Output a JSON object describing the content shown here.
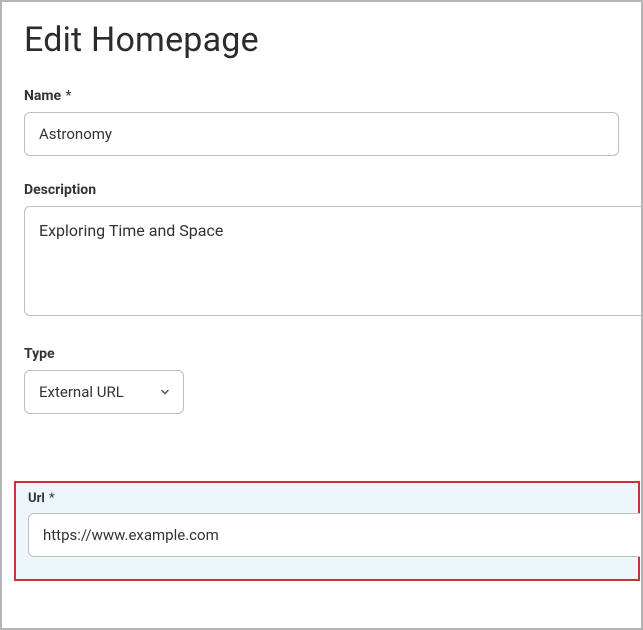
{
  "page": {
    "title": "Edit Homepage"
  },
  "fields": {
    "name": {
      "label": "Name",
      "required_marker": "*",
      "value": "Astronomy"
    },
    "description": {
      "label": "Description",
      "value": "Exploring Time and Space"
    },
    "type": {
      "label": "Type",
      "selected": "External URL"
    },
    "url": {
      "label": "Url",
      "required_marker": "*",
      "value": "https://www.example.com"
    }
  }
}
